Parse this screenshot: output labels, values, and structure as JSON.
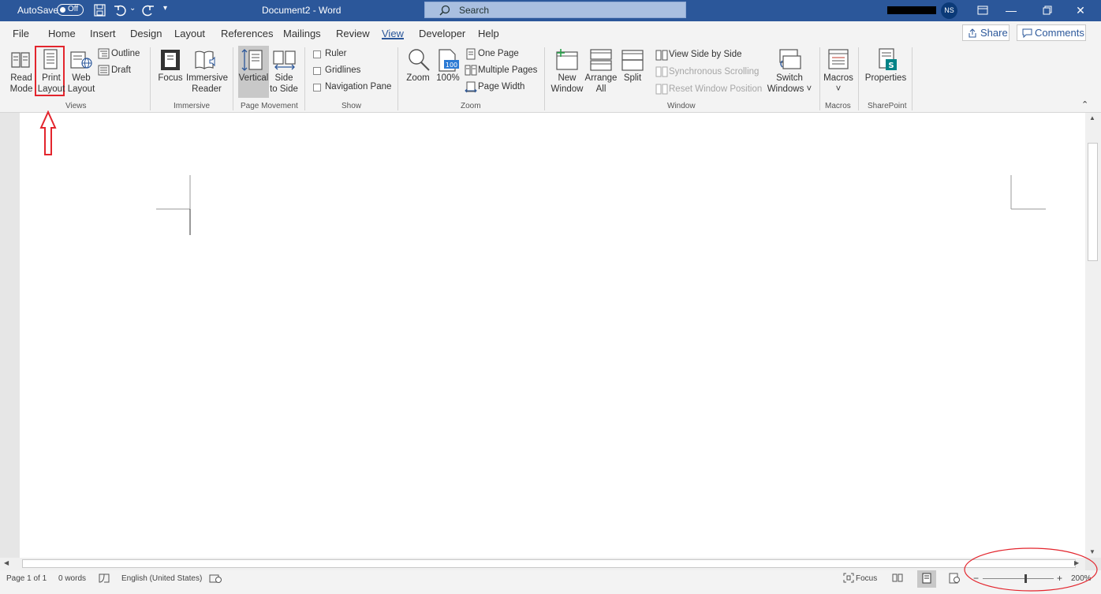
{
  "titlebar": {
    "autosave_label": "AutoSave",
    "autosave_state": "Off",
    "doc_title": "Document2 - Word",
    "search_placeholder": "Search",
    "user_initials": "NS",
    "accent": "#2b579a"
  },
  "tabs": [
    "File",
    "Home",
    "Insert",
    "Design",
    "Layout",
    "References",
    "Mailings",
    "Review",
    "View",
    "Developer",
    "Help"
  ],
  "active_tab": "View",
  "share_label": "Share",
  "comments_label": "Comments",
  "ribbon": {
    "views": {
      "read_mode": [
        "Read",
        "Mode"
      ],
      "print_layout": [
        "Print",
        "Layout"
      ],
      "web_layout": [
        "Web",
        "Layout"
      ],
      "outline": "Outline",
      "draft": "Draft",
      "group": "Views"
    },
    "immersive": {
      "focus": "Focus",
      "immersive_reader": [
        "Immersive",
        "Reader"
      ],
      "group": "Immersive"
    },
    "page_movement": {
      "vertical": "Vertical",
      "side_to_side": [
        "Side",
        "to Side"
      ],
      "group": "Page Movement"
    },
    "show": {
      "ruler": "Ruler",
      "gridlines": "Gridlines",
      "navigation_pane": "Navigation Pane",
      "group": "Show"
    },
    "zoom": {
      "zoom": "Zoom",
      "hundred": "100%",
      "one_page": "One Page",
      "multiple_pages": "Multiple Pages",
      "page_width": "Page Width",
      "group": "Zoom"
    },
    "window": {
      "new_window": [
        "New",
        "Window"
      ],
      "arrange_all": [
        "Arrange",
        "All"
      ],
      "split": "Split",
      "view_side_by_side": "View Side by Side",
      "synchronous_scrolling": "Synchronous Scrolling",
      "reset_window_position": "Reset Window Position",
      "switch_windows": [
        "Switch",
        "Windows"
      ],
      "group": "Window"
    },
    "macros": {
      "macros": "Macros",
      "group": "Macros"
    },
    "sharepoint": {
      "properties": "Properties",
      "group": "SharePoint"
    }
  },
  "status": {
    "page": "Page 1 of 1",
    "words": "0 words",
    "language": "English (United States)",
    "focus": "Focus",
    "zoom": "200%",
    "zoom_fraction": 0.6
  },
  "annotation_color": "#e3252d"
}
